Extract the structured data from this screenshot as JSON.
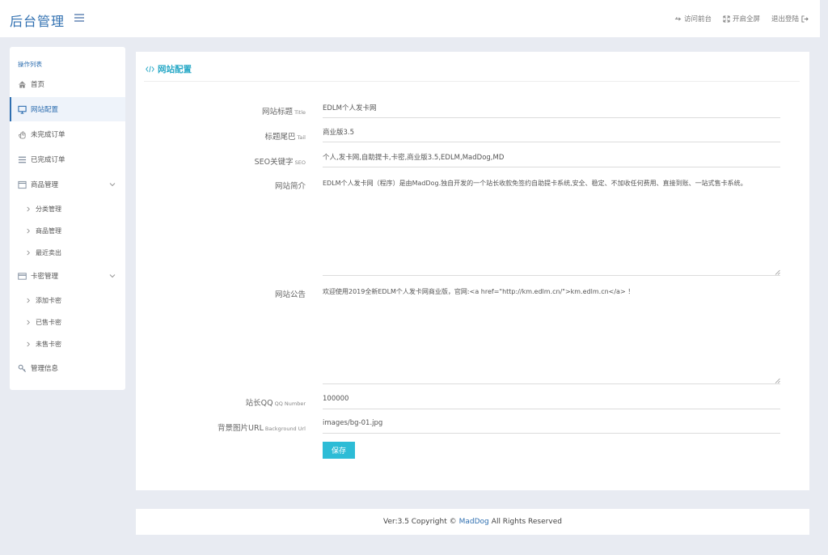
{
  "header": {
    "brand": "后台管理",
    "links": [
      {
        "icon": "usb-icon",
        "label": "访问前台"
      },
      {
        "icon": "expand-icon",
        "label": "开启全屏"
      },
      {
        "icon": "logout-icon",
        "label": "退出登陆"
      }
    ]
  },
  "sidebar": {
    "title": "操作列表",
    "items": [
      {
        "label": "首页",
        "icon": "home-icon"
      },
      {
        "label": "网站配置",
        "icon": "monitor-icon",
        "active": true
      },
      {
        "label": "未完成订单",
        "icon": "hand-icon"
      },
      {
        "label": "已完成订单",
        "icon": "list-icon"
      },
      {
        "label": "商品管理",
        "icon": "window-icon",
        "expandable": true
      },
      {
        "label": "分类管理",
        "sub": true
      },
      {
        "label": "商品管理",
        "sub": true
      },
      {
        "label": "最近卖出",
        "sub": true
      },
      {
        "label": "卡密管理",
        "icon": "card-icon",
        "expandable": true
      },
      {
        "label": "添加卡密",
        "sub": true
      },
      {
        "label": "已售卡密",
        "sub": true
      },
      {
        "label": "未售卡密",
        "sub": true
      },
      {
        "label": "管理信息",
        "icon": "key-icon"
      }
    ]
  },
  "main": {
    "heading": "网站配置",
    "fields": {
      "title": {
        "label": "网站标题",
        "hint": "Title",
        "value": "EDLM个人发卡网"
      },
      "tail": {
        "label": "标题尾巴",
        "hint": "Tail",
        "value": "商业版3.5"
      },
      "seo": {
        "label": "SEO关键字",
        "hint": "SEO",
        "value": "个人,发卡网,自助提卡,卡密,商业版3.5,EDLM,MadDog,MD"
      },
      "intro": {
        "label": "网站简介",
        "hint": "",
        "value": "EDLM个人发卡网（程序）是由MadDog.独自开发的一个站长收款免签约自助提卡系统,安全、稳定、不加收任何费用、直接到账、一站式售卡系统。"
      },
      "notice": {
        "label": "网站公告",
        "hint": "",
        "value": "欢迎使用2019全新EDLM个人发卡网商业版，官网:<a href=\"http://km.edlm.cn/\">km.edlm.cn</a> ！"
      },
      "qq": {
        "label": "站长QQ",
        "hint": "QQ Number",
        "value": "100000"
      },
      "bg": {
        "label": "背景图片URL",
        "hint": "Background Url",
        "value": "images/bg-01.jpg"
      }
    },
    "save_label": "保存"
  },
  "footer": {
    "prefix": "Ver:3.5 Copyright ©",
    "author": "MadDog",
    "suffix": "All Rights Reserved"
  },
  "colors": {
    "brand": "#2f6fb0",
    "accent": "#2dbcd6",
    "background": "#e8ebf2"
  }
}
